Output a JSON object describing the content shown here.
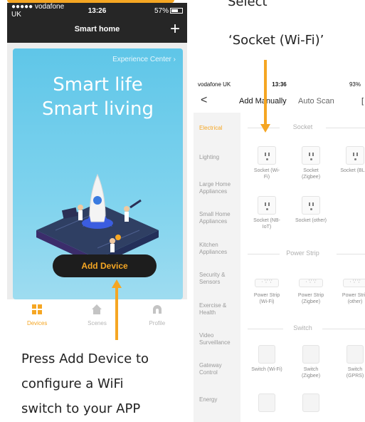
{
  "left_phone": {
    "status": {
      "carrier": "●●●●● vodafone UK",
      "time": "13:26",
      "battery": "57%"
    },
    "header": {
      "title": "Smart home",
      "add_icon": "plus-icon"
    },
    "banner": {
      "link": "Experience Center ›",
      "line1": "Smart life",
      "line2": "Smart living"
    },
    "add_device_label": "Add Device",
    "tabs": [
      {
        "label": "Devices",
        "icon": "grid-icon",
        "active": true
      },
      {
        "label": "Scenes",
        "icon": "home-icon",
        "active": false
      },
      {
        "label": "Profile",
        "icon": "profile-icon",
        "active": false
      }
    ]
  },
  "right_phone": {
    "status": {
      "carrier": "vodafone UK",
      "time": "13:36",
      "battery": "93%"
    },
    "nav": {
      "back": "<",
      "tab_manual": "Add Manually",
      "tab_scan": "Auto Scan"
    },
    "categories": [
      {
        "label": "Electrical",
        "active": true
      },
      {
        "label": "Lighting",
        "active": false
      },
      {
        "label": "Large Home Appliances",
        "active": false
      },
      {
        "label": "Small Home Appliances",
        "active": false
      },
      {
        "label": "Kitchen Appliances",
        "active": false
      },
      {
        "label": "Security & Sensors",
        "active": false
      },
      {
        "label": "Exercise & Health",
        "active": false
      },
      {
        "label": "Video Surveillance",
        "active": false
      },
      {
        "label": "Gateway Control",
        "active": false
      },
      {
        "label": "Energy",
        "active": false
      }
    ],
    "sections": {
      "socket": "Socket",
      "power_strip": "Power Strip",
      "switch": "Switch"
    },
    "socket_items": [
      "Socket (Wi-Fi)",
      "Socket (Zigbee)",
      "Socket (BLE)",
      "Socket (NB-IoT)",
      "Socket (other)"
    ],
    "strip_items": [
      "Power Strip (Wi-Fi)",
      "Power Strip (Zigbee)",
      "Power Strip (other)"
    ],
    "switch_items": [
      "Switch (Wi-Fi)",
      "Switch (Zigbee)",
      "Switch (GPRS)"
    ]
  },
  "captions": {
    "select_line1": "Select",
    "select_line2": "‘Socket (Wi-Fi)’",
    "press_line1": "Press Add Device to",
    "press_line2": "configure a WiFi",
    "press_line3": "switch to your APP"
  },
  "colors": {
    "accent": "#f5a623",
    "dark": "#262626"
  }
}
